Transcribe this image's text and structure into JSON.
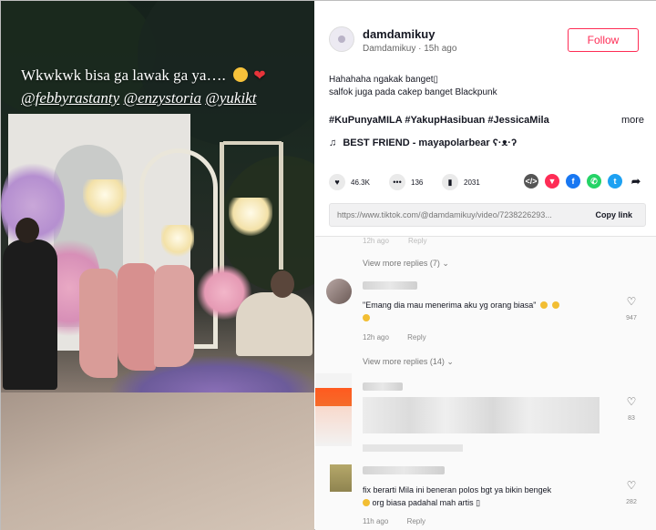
{
  "video": {
    "caption_line1": "Wkwkwk bisa ga lawak ga ya….",
    "mention_1": "@febbyrastanty",
    "mention_2": "@enzystoria",
    "mention_3": "@yukikt"
  },
  "post": {
    "username": "damdamikuy",
    "display_name": "Damdamikuy",
    "time_ago": "15h ago",
    "follow_label": "Follow",
    "description_line1": "Hahahaha ngakak banget▯",
    "description_line2": "salfok juga pada cakep banget Blackpunk",
    "hashtags": "#KuPunyaMILA #YakupHasibuan #JessicaMila",
    "more_label": "more",
    "music": "BEST FRIEND - mayapolarbear ʕ·ᴥ·ʔ",
    "likes": "46.3K",
    "comments_count": "136",
    "saves": "2031",
    "link_url": "https://www.tiktok.com/@damdamikuy/video/7238226293...",
    "copy_link_label": "Copy link"
  },
  "comments": {
    "top_faded_meta": "12h ago",
    "top_faded_reply": "Reply",
    "view_more_1": "View more replies (7)",
    "comment1_text": "\"Emang dia mau menerima aku yg orang biasa\"",
    "comment1_time": "12h ago",
    "comment1_reply": "Reply",
    "comment1_likes": "947",
    "view_more_2": "View more replies (14)",
    "comment2_likes": "83",
    "comment3_text_line1": "fix berarti Mila ini beneran polos bgt ya bikin bengek",
    "comment3_text_line2": "org biasa padahal mah artis ▯",
    "comment3_time": "11h ago",
    "comment3_reply": "Reply",
    "comment3_likes": "282"
  },
  "colors": {
    "follow_red": "#fe2c55",
    "text_dark": "#161823",
    "share_embed": "#555555",
    "share_tiktok": "#fe2c55",
    "share_facebook": "#1877f2",
    "share_whatsapp": "#25d366",
    "share_twitter": "#1da1f2"
  },
  "icons": {
    "like": "heart-icon",
    "comment": "comment-bubble-icon",
    "save": "bookmark-icon",
    "share_embed": "embed-code-icon",
    "share_tiktok": "tiktok-send-icon",
    "share_facebook": "facebook-icon",
    "share_whatsapp": "whatsapp-icon",
    "share_twitter": "twitter-icon",
    "share_more": "share-arrow-icon",
    "music": "music-note-icon",
    "comment_like": "heart-outline-icon"
  }
}
